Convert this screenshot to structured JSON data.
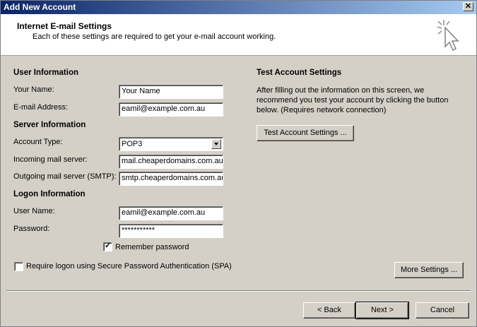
{
  "window": {
    "title": "Add New Account"
  },
  "header": {
    "title": "Internet E-mail Settings",
    "subtitle": "Each of these settings are required to get your e-mail account working."
  },
  "user_info": {
    "title": "User Information",
    "name_label": "Your Name:",
    "name_value": "Your Name",
    "email_label": "E-mail Address:",
    "email_value": "eamil@example.com.au"
  },
  "server_info": {
    "title": "Server Information",
    "account_type_label": "Account Type:",
    "account_type_value": "POP3",
    "incoming_label": "Incoming mail server:",
    "incoming_value": "mail.cheaperdomains.com.au",
    "outgoing_label": "Outgoing mail server (SMTP):",
    "outgoing_value": "smtp.cheaperdomains.com.au"
  },
  "logon_info": {
    "title": "Logon Information",
    "username_label": "User Name:",
    "username_value": "eamil@example.com.au",
    "password_label": "Password:",
    "password_value": "***********",
    "remember_label": "Remember password",
    "remember_checked": true,
    "spa_label": "Require logon using Secure Password Authentication (SPA)",
    "spa_checked": false
  },
  "test_settings": {
    "title": "Test Account Settings",
    "description": "After filling out the information on this screen, we recommend you test your account by clicking the button below.  (Requires network connection)",
    "button_label": "Test Account Settings ..."
  },
  "buttons": {
    "more_settings": "More Settings ...",
    "back": "< Back",
    "next": "Next >",
    "cancel": "Cancel"
  },
  "icons": {
    "close": "close-icon",
    "wizard": "cursor-sparkle-icon",
    "dropdown": "chevron-down-icon"
  }
}
